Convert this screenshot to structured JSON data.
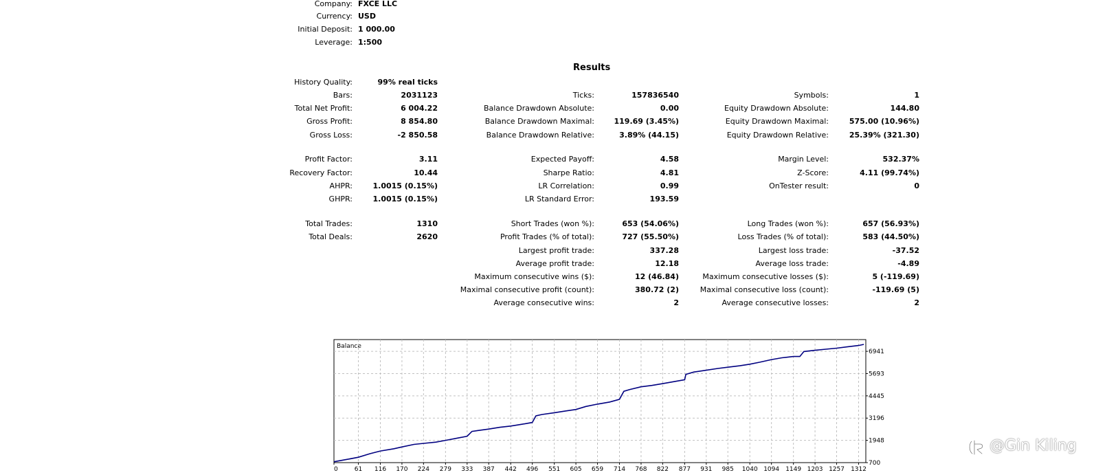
{
  "header": {
    "company_label": "Company:",
    "company_value": "FXCE LLC",
    "currency_label": "Currency:",
    "currency_value": "USD",
    "deposit_label": "Initial Deposit:",
    "deposit_value": "1 000.00",
    "leverage_label": "Leverage:",
    "leverage_value": "1:500"
  },
  "results": {
    "title": "Results",
    "history_quality_label": "History Quality:",
    "history_quality_value": "99% real ticks",
    "col1": [
      {
        "label": "Bars:",
        "value": "2031123"
      },
      {
        "label": "Total Net Profit:",
        "value": "6 004.22"
      },
      {
        "label": "Gross Profit:",
        "value": "8 854.80"
      },
      {
        "label": "Gross Loss:",
        "value": "-2 850.58"
      },
      {
        "label": "Profit Factor:",
        "value": "3.11"
      },
      {
        "label": "Recovery Factor:",
        "value": "10.44"
      },
      {
        "label": "AHPR:",
        "value": "1.0015 (0.15%)"
      },
      {
        "label": "GHPR:",
        "value": "1.0015 (0.15%)"
      },
      {
        "label": "Total Trades:",
        "value": "1310"
      },
      {
        "label": "Total Deals:",
        "value": "2620"
      }
    ],
    "col2": [
      {
        "label": "Ticks:",
        "value": "157836540"
      },
      {
        "label": "Balance Drawdown Absolute:",
        "value": "0.00"
      },
      {
        "label": "Balance Drawdown Maximal:",
        "value": "119.69 (3.45%)"
      },
      {
        "label": "Balance Drawdown Relative:",
        "value": "3.89% (44.15)"
      },
      {
        "label": "Expected Payoff:",
        "value": "4.58"
      },
      {
        "label": "Sharpe Ratio:",
        "value": "4.81"
      },
      {
        "label": "LR Correlation:",
        "value": "0.99"
      },
      {
        "label": "LR Standard Error:",
        "value": "193.59"
      },
      {
        "label": "Short Trades (won %):",
        "value": "653 (54.06%)"
      },
      {
        "label": "Profit Trades (% of total):",
        "value": "727 (55.50%)"
      },
      {
        "label": "Largest profit trade:",
        "value": "337.28"
      },
      {
        "label": "Average profit trade:",
        "value": "12.18"
      },
      {
        "label": "Maximum consecutive wins ($):",
        "value": "12 (46.84)"
      },
      {
        "label": "Maximal consecutive profit (count):",
        "value": "380.72 (2)"
      },
      {
        "label": "Average consecutive wins:",
        "value": "2"
      }
    ],
    "col3": [
      {
        "label": "Symbols:",
        "value": "1"
      },
      {
        "label": "Equity Drawdown Absolute:",
        "value": "144.80"
      },
      {
        "label": "Equity Drawdown Maximal:",
        "value": "575.00 (10.96%)"
      },
      {
        "label": "Equity Drawdown Relative:",
        "value": "25.39% (321.30)"
      },
      {
        "label": "Margin Level:",
        "value": "532.37%"
      },
      {
        "label": "Z-Score:",
        "value": "4.11 (99.74%)"
      },
      {
        "label": "OnTester result:",
        "value": "0"
      },
      {
        "label": "Long Trades (won %):",
        "value": "657 (56.93%)"
      },
      {
        "label": "Loss Trades (% of total):",
        "value": "583 (44.50%)"
      },
      {
        "label": "Largest loss trade:",
        "value": "-37.52"
      },
      {
        "label": "Average loss trade:",
        "value": "-4.89"
      },
      {
        "label": "Maximum consecutive losses ($):",
        "value": "5 (-119.69)"
      },
      {
        "label": "Maximal consecutive loss (count):",
        "value": "-119.69 (5)"
      },
      {
        "label": "Average consecutive losses:",
        "value": "2"
      }
    ]
  },
  "watermark": {
    "text": "@Gin Kiling",
    "icon": "zhihu-logo-icon"
  },
  "colors": {
    "balance_line": "#000080",
    "grid": "#c0c0c0",
    "frame": "#000000"
  },
  "chart_data": {
    "type": "line",
    "title": "Balance",
    "x_ticks": [
      0,
      61,
      116,
      170,
      224,
      279,
      333,
      387,
      442,
      496,
      551,
      605,
      659,
      714,
      768,
      822,
      877,
      931,
      985,
      1040,
      1094,
      1149,
      1203,
      1257,
      1312
    ],
    "y_ticks": [
      700,
      1948,
      3196,
      4445,
      5693,
      6941
    ],
    "xlim": [
      0,
      1330
    ],
    "ylim": [
      700,
      7600
    ],
    "grid": true,
    "series": [
      {
        "values_x": [
          0,
          30,
          61,
          90,
          116,
          150,
          170,
          200,
          224,
          255,
          279,
          310,
          333,
          345,
          360,
          387,
          415,
          442,
          470,
          496,
          505,
          520,
          551,
          580,
          605,
          630,
          659,
          690,
          714,
          725,
          740,
          768,
          795,
          822,
          850,
          877,
          880,
          900,
          931,
          960,
          985,
          1015,
          1040,
          1065,
          1094,
          1120,
          1149,
          1165,
          1175,
          1203,
          1230,
          1257,
          1285,
          1312,
          1325
        ],
        "values_y": [
          750,
          870,
          1000,
          1200,
          1350,
          1480,
          1580,
          1720,
          1780,
          1850,
          1950,
          2080,
          2180,
          2450,
          2500,
          2580,
          2680,
          2750,
          2850,
          2950,
          3320,
          3400,
          3500,
          3600,
          3680,
          3850,
          3980,
          4100,
          4250,
          4700,
          4800,
          4950,
          5030,
          5130,
          5240,
          5350,
          5650,
          5780,
          5880,
          5980,
          6050,
          6130,
          6220,
          6330,
          6480,
          6580,
          6650,
          6650,
          6930,
          7000,
          7060,
          7120,
          7200,
          7270,
          7330
        ]
      }
    ]
  }
}
